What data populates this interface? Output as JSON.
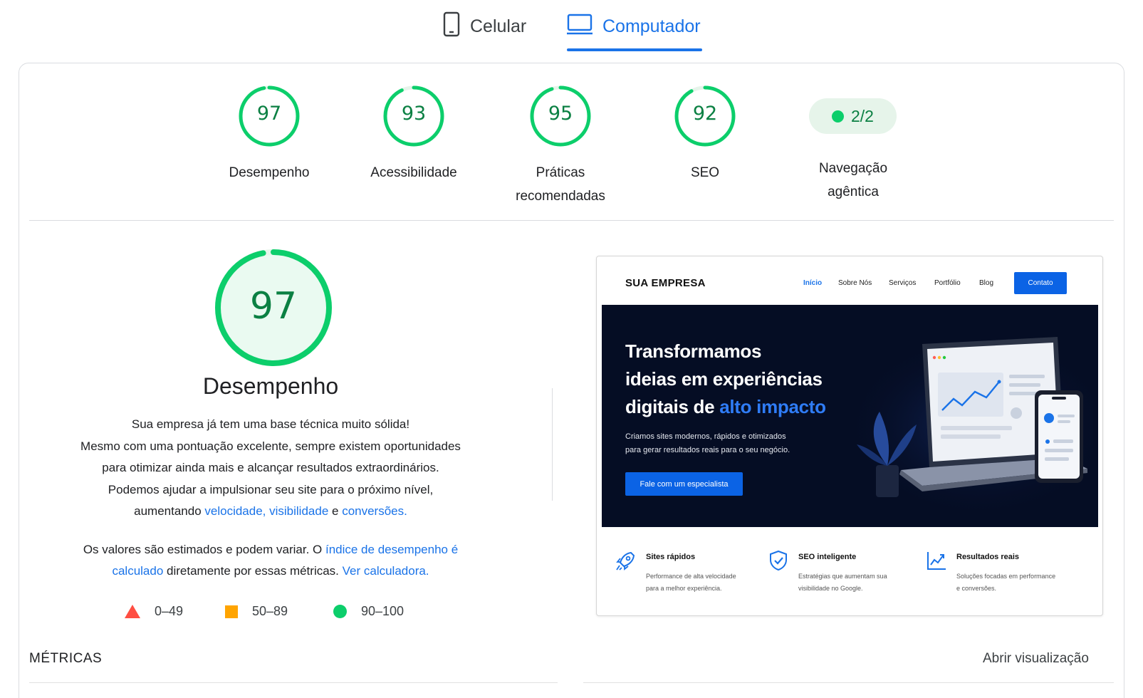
{
  "tabs": {
    "mobile": "Celular",
    "desktop": "Computador",
    "selected": "Computador"
  },
  "scores": [
    {
      "value": "97",
      "label": "Desempenho",
      "percent": 97
    },
    {
      "value": "93",
      "label": "Acessibilidade",
      "percent": 93
    },
    {
      "value": "95",
      "label_line1": "Práticas",
      "label_line2": "recomendadas",
      "percent": 95
    },
    {
      "value": "92",
      "label": "SEO",
      "percent": 92
    }
  ],
  "agentic": {
    "value": "2/2",
    "label_line1": "Navegação",
    "label_line2": "agêntica"
  },
  "performance": {
    "score": "97",
    "percent": 97,
    "title": "Desempenho",
    "line1": "Sua empresa já tem uma base técnica muito sólida!",
    "line2": "Mesmo com uma pontuação excelente, sempre existem oportunidades",
    "line3": "para otimizar ainda mais e alcançar resultados extraordinários.",
    "line4": "Podemos ajudar a impulsionar seu site para o próximo nível,",
    "line5_pre": "aumentando ",
    "link_velocidade": "velocidade, visibilidade",
    "line5_mid": " e ",
    "link_conversoes": "conversões.",
    "estimate_pre": "Os valores são estimados e podem variar. O ",
    "estimate_link1": "índice de desempenho é calculado",
    "estimate_mid": " diretamente por essas métricas. ",
    "estimate_link2": "Ver calculadora."
  },
  "legend": {
    "fail": "0–49",
    "average": "50–89",
    "pass": "90–100"
  },
  "metrics_label": "MÉTRICAS",
  "open_view": "Abrir visualização",
  "preview": {
    "brand": "SUA EMPRESA",
    "menu": [
      "Início",
      "Sobre Nós",
      "Serviços",
      "Portfólio",
      "Blog"
    ],
    "contact": "Contato",
    "headline_1": "Transformamos",
    "headline_2": "ideias em experiências",
    "headline_3": "digitais de ",
    "headline_highlight": "alto impacto",
    "subtext_1": "Criamos sites modernos, rápidos e otimizados",
    "subtext_2": "para gerar resultados reais para o seu negócio.",
    "cta": "Fale com um especialista",
    "features": [
      {
        "icon": "rocket-icon",
        "title": "Sites rápidos",
        "desc_1": "Performance de alta velocidade",
        "desc_2": "para a melhor experiência."
      },
      {
        "icon": "shield-check-icon",
        "title": "SEO inteligente",
        "desc_1": "Estratégias que aumentam sua",
        "desc_2": "visibilidade no Google."
      },
      {
        "icon": "chart-up-icon",
        "title": "Resultados reais",
        "desc_1": "Soluções focadas em performance",
        "desc_2": "e conversões."
      }
    ]
  },
  "colors": {
    "pass": "#0cce6b",
    "pass_text": "#0b8043",
    "average": "#ffa400",
    "fail": "#ff4e42",
    "link": "#1a73e8",
    "hero_bg": "#050d24"
  }
}
